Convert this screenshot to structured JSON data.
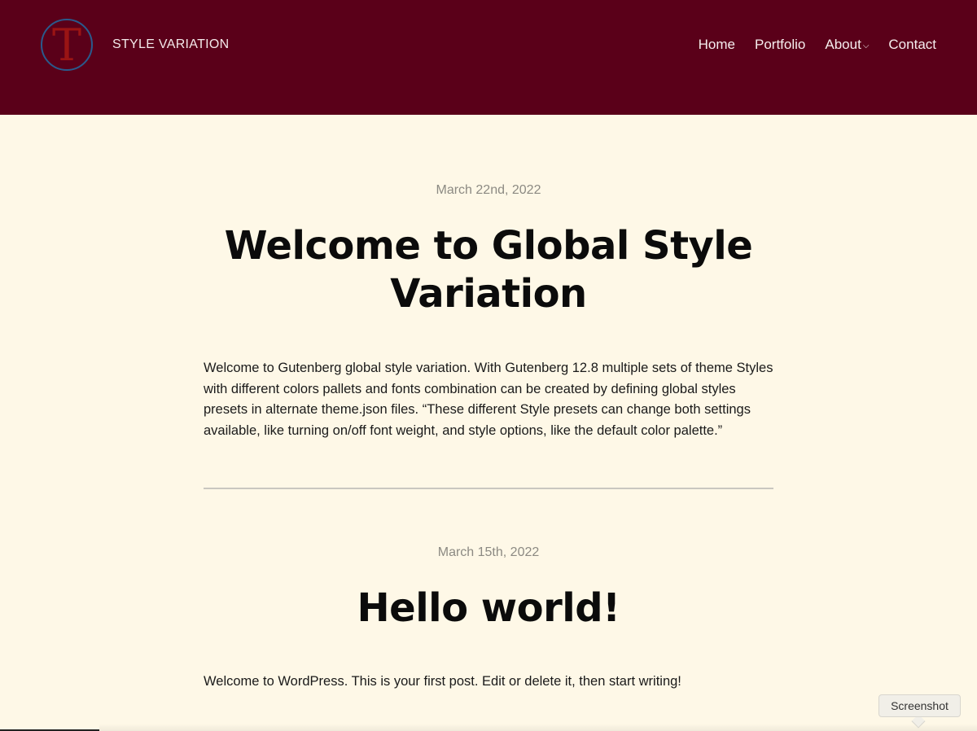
{
  "header": {
    "logo_letter": "T",
    "site_title": "STYLE VARIATION",
    "nav": [
      {
        "label": "Home"
      },
      {
        "label": "Portfolio"
      },
      {
        "label": "About",
        "chevron": "⌵"
      },
      {
        "label": "Contact"
      }
    ]
  },
  "posts": [
    {
      "date": "March 22nd, 2022",
      "title": "Welcome to Global Style Variation",
      "body": "Welcome to Gutenberg global style variation. With Gutenberg 12.8 multiple sets of theme Styles with different colors pallets and fonts combination can be created by defining global styles presets in alternate theme.json files. “These different Style presets can change both settings available, like turning on/off font weight, and style options, like the default color palette.”"
    },
    {
      "date": "March 15th, 2022",
      "title": "Hello world!",
      "body": "Welcome to WordPress. This is your first post. Edit or delete it, then start writing!"
    }
  ],
  "tooltip": {
    "label": "Screenshot"
  },
  "colors": {
    "header_bg": "#5a0019",
    "page_bg": "#fef8e7"
  }
}
